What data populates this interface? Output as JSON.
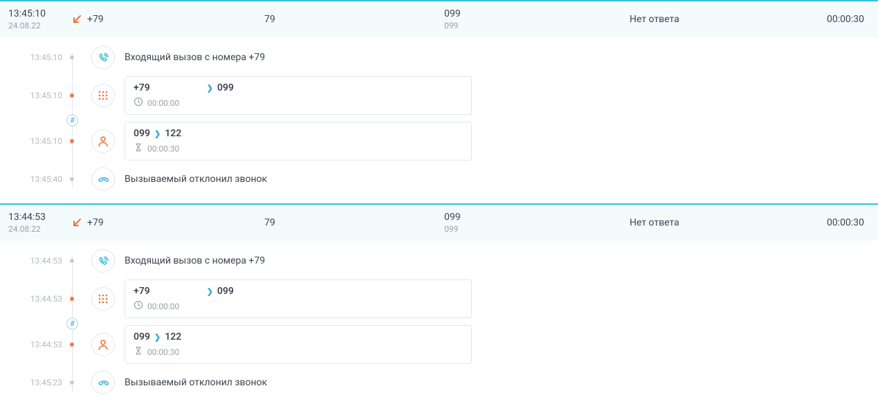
{
  "calls": [
    {
      "summary": {
        "time": "13:45:10",
        "date": "24.08.22",
        "from": "+79",
        "via": "79",
        "to_main": "099",
        "to_sub": "099",
        "status": "Нет ответа",
        "duration": "00:00:30"
      },
      "hash_label": "#",
      "steps": [
        {
          "time": "13:45:10",
          "kind": "incoming",
          "text": "Входящий вызов с номера +79"
        },
        {
          "time": "13:45:10",
          "kind": "dial",
          "card": {
            "a": "+79",
            "b": "099",
            "dur_label": "00:00:00",
            "dur_icon": "clock"
          }
        },
        {
          "time": "13:45:10",
          "kind": "route",
          "card": {
            "a": "099",
            "b": "122",
            "dur_label": "00:00:30",
            "dur_icon": "hourglass"
          }
        },
        {
          "time": "13:45:40",
          "kind": "end",
          "text": "Вызываемый отклонил звонок"
        }
      ]
    },
    {
      "summary": {
        "time": "13:44:53",
        "date": "24.08.22",
        "from": "+79",
        "via": "79",
        "to_main": "099",
        "to_sub": "099",
        "status": "Нет ответа",
        "duration": "00:00:30"
      },
      "hash_label": "#",
      "steps": [
        {
          "time": "13:44:53",
          "kind": "incoming",
          "text": "Входящий вызов с номера +79"
        },
        {
          "time": "13:44:53",
          "kind": "dial",
          "card": {
            "a": "+79",
            "b": "099",
            "dur_label": "00:00:00",
            "dur_icon": "clock"
          }
        },
        {
          "time": "13:44:53",
          "kind": "route",
          "card": {
            "a": "099",
            "b": "122",
            "dur_label": "00:00:30",
            "dur_icon": "hourglass"
          }
        },
        {
          "time": "13:45:23",
          "kind": "end",
          "text": "Вызываемый отклонил звонок"
        }
      ]
    }
  ]
}
